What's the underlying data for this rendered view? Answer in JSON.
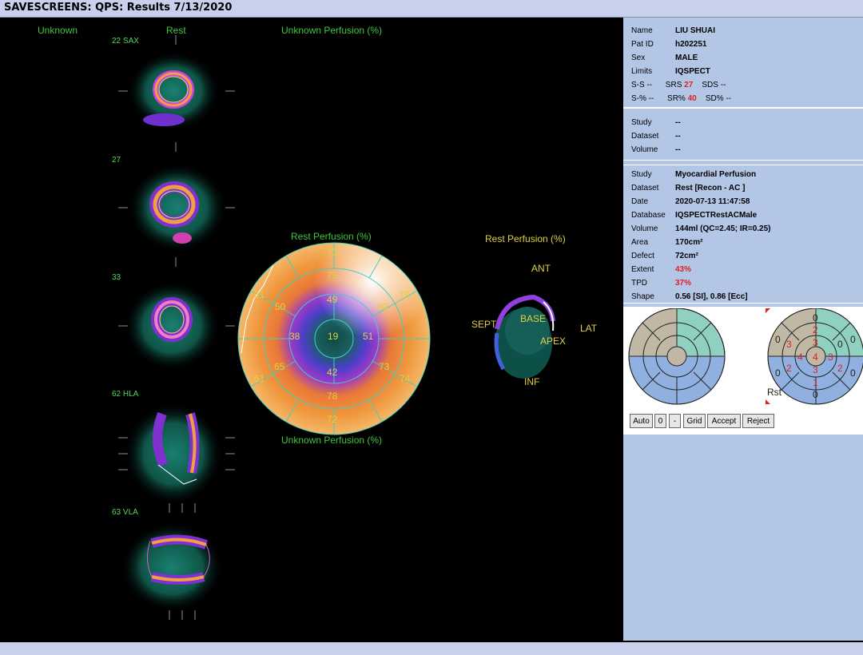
{
  "window": {
    "title": "SAVESCREENS: QPS: Results 7/13/2020"
  },
  "headers": {
    "unknown": "Unknown",
    "rest": "Rest",
    "unknown_perfusion_top": "Unknown Perfusion (%)",
    "unknown_perfusion_bottom": "Unknown Perfusion (%)"
  },
  "slices": {
    "sax": "22 SAX",
    "s27": "27",
    "s33": "33",
    "hla": "62 HLA",
    "vla": "63 VLA"
  },
  "polar": {
    "title": "Rest Perfusion (%)",
    "values": {
      "apex": "19",
      "mid_ant": "49",
      "mid_lat": "51",
      "mid_inf": "42",
      "mid_sept": "38",
      "c1": "75",
      "c2": "90",
      "c3": "73",
      "c4": "78",
      "c5": "65",
      "c6": "50",
      "b1": "73",
      "b2": "79",
      "b3": "74",
      "b4": "72",
      "b5": "61",
      "b6": "61"
    }
  },
  "volume3d": {
    "title": "Rest Perfusion (%)",
    "ant": "ANT",
    "sept": "SEPT",
    "base": "BASE",
    "lat": "LAT",
    "apex": "APEX",
    "inf": "INF"
  },
  "patient": {
    "name_k": "Name",
    "name_v": "LIU SHUAI",
    "id_k": "Pat ID",
    "id_v": "h202251",
    "sex_k": "Sex",
    "sex_v": "MALE",
    "limits_k": "Limits",
    "limits_v": "IQSPECT",
    "ss_k": "S-S",
    "ss_v": "--",
    "srs_k": "SRS",
    "srs_v": "27",
    "sds_k": "SDS",
    "sds_v": "--",
    "sp_k": "S-%",
    "sp_v": "--",
    "srp_k": "SR%",
    "srp_v": "40",
    "sdp_k": "SD%",
    "sdp_v": "--"
  },
  "study1": {
    "study_k": "Study",
    "study_v": "--",
    "dataset_k": "Dataset",
    "dataset_v": "--",
    "volume_k": "Volume",
    "volume_v": "--"
  },
  "study2": {
    "study_k": "Study",
    "study_v": "Myocardial Perfusion",
    "dataset_k": "Dataset",
    "dataset_v": "Rest [Recon - AC ]",
    "date_k": "Date",
    "date_v": "2020-07-13 11:47:58",
    "database_k": "Database",
    "database_v": "IQSPECTRestACMale",
    "volume_k": "Volume",
    "volume_v": "144ml (QC=2.45; IR=0.25)",
    "area_k": "Area",
    "area_v": "170cm²",
    "defect_k": "Defect",
    "defect_v": "72cm²",
    "extent_k": "Extent",
    "extent_v": "43%",
    "tpd_k": "TPD",
    "tpd_v": "37%",
    "shape_k": "Shape",
    "shape_v": "0.56 [SI],  0.86 [Ecc]"
  },
  "scores": {
    "label": "Rst",
    "apex": "4",
    "mid_ant": "3",
    "mid_lat": "3",
    "mid_inf": "3",
    "mid_sept": "4",
    "c_ant": "2",
    "c_antlat": "0",
    "c_inflat": "2",
    "c_inf": "1",
    "c_infsept": "2",
    "c_antsept": "3",
    "b_ant": "0",
    "b_antlat": "0",
    "b_inflat": "0",
    "b_inf": "0",
    "b_infsept": "0",
    "b_antsept": "0"
  },
  "buttons": {
    "auto": "Auto",
    "zero": "0",
    "minus": "-",
    "grid": "Grid",
    "accept": "Accept",
    "reject": "Reject"
  },
  "colors": {
    "panel": "#b4c6e6",
    "title": "#c8d0ec",
    "score_red": "#e02020",
    "region_tan": "#c0b8a4",
    "region_teal": "#90d0c0",
    "region_blue": "#90b0e0"
  }
}
